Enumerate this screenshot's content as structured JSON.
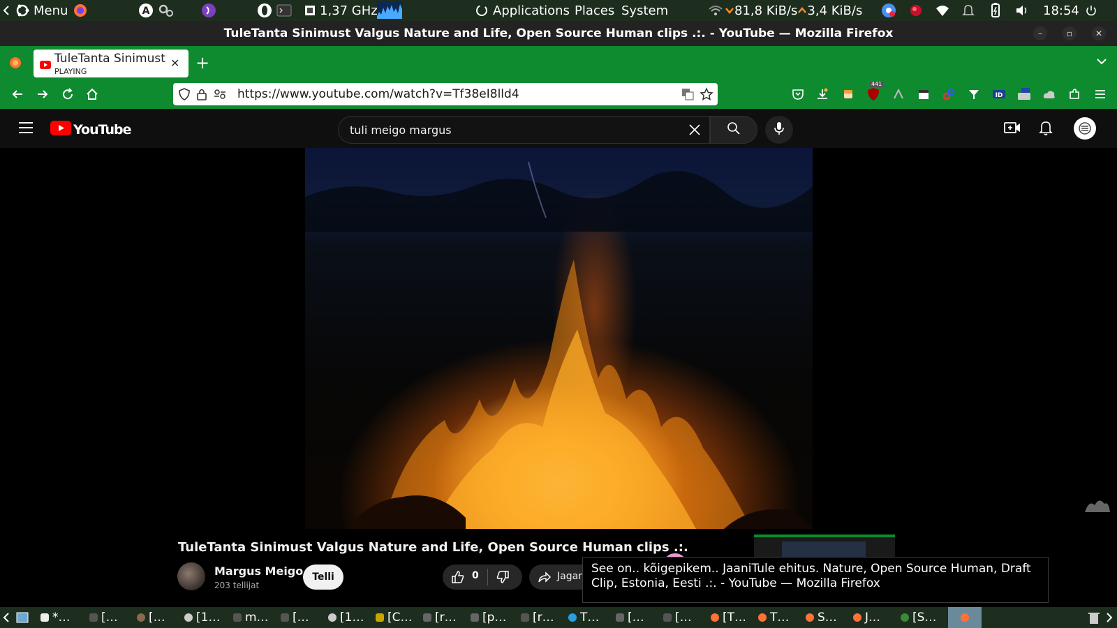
{
  "system_panel": {
    "menu_label": "Menu",
    "cpu_freq": "1,37 GHz",
    "applications": "Applications",
    "places": "Places",
    "system": "System",
    "net_down": "81,8 KiB/s",
    "net_up": "3,4 KiB/s",
    "clock": "18:54"
  },
  "window": {
    "title": "TuleTanta Sinimust Valgus Nature and Life, Open Source Human clips .:. - YouTube — Mozilla Firefox"
  },
  "browser": {
    "tab_title": "TuleTanta Sinimust Valgus",
    "tab_status": "PLAYING",
    "url": "https://www.youtube.com/watch?v=Tf38eI8lld4",
    "badge_count": "441"
  },
  "youtube": {
    "logo_text": "YouTube",
    "search_query": "tuli meigo margus",
    "video_title": "TuleTanta Sinimust Valgus Nature and Life, Open Source Human clips .:.",
    "channel_name": "Margus Meigo",
    "subscribers": "203 tellijat",
    "subscribe_label": "Telli",
    "like_count": "0",
    "share_label": "Jagan"
  },
  "tooltip": {
    "text": "See on.. kõigepikem.. JaaniTule ehitus. Nature, Open Source Human, Draft Clip, Estonia, Eesti .:. - YouTube — Mozilla Firefox"
  },
  "taskbar": {
    "items": [
      "*…",
      "[…",
      "[…",
      "[1…",
      "m…",
      "[…",
      "[1…",
      "[C…",
      "[r…",
      "[p…",
      "[r…",
      "T…",
      "[…",
      "[…",
      "[T…",
      "T…",
      "S…",
      "J…",
      "[S…"
    ]
  },
  "colors": {
    "browser_green": "#0e8a2f",
    "yt_red": "#ff0000",
    "panel_bg": "#1d2d1e"
  }
}
